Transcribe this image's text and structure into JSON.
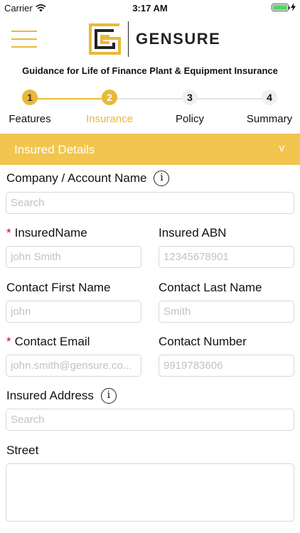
{
  "status_bar": {
    "carrier": "Carrier",
    "time": "3:17 AM",
    "battery_level": 1.0
  },
  "header": {
    "menu_icon": "hamburger-menu-icon",
    "logo_icon": "gensure-logo-mark",
    "brand": "GENSURE"
  },
  "page_title": "Guidance for Life of Finance Plant & Equipment Insurance",
  "stepper": {
    "current_step": 2,
    "steps": [
      {
        "number": "1",
        "label": "Features",
        "state": "done"
      },
      {
        "number": "2",
        "label": "Insurance",
        "state": "active"
      },
      {
        "number": "3",
        "label": "Policy",
        "state": "todo"
      },
      {
        "number": "4",
        "label": "Summary",
        "state": "todo"
      }
    ]
  },
  "section": {
    "title": "Insured Details",
    "chevron": "v"
  },
  "form": {
    "company": {
      "label": "Company / Account Name",
      "placeholder": "Search",
      "info": "i"
    },
    "insured_name": {
      "required": "*",
      "label": "InsuredName",
      "placeholder": "john Smith"
    },
    "insured_abn": {
      "label": "Insured ABN",
      "placeholder": "12345678901"
    },
    "contact_first": {
      "label": "Contact First Name",
      "placeholder": "john"
    },
    "contact_last": {
      "label": "Contact Last Name",
      "placeholder": "Smith"
    },
    "contact_email": {
      "required": "*",
      "label": "Contact Email",
      "placeholder": "john.smith@gensure.co..."
    },
    "contact_number": {
      "label": "Contact Number",
      "placeholder": "9919783606"
    },
    "insured_address": {
      "label": "Insured Address",
      "placeholder": "Search",
      "info": "i"
    },
    "street": {
      "label": "Street",
      "placeholder": ""
    }
  },
  "colors": {
    "accent": "#f2c54f",
    "accent_dark": "#e8b83a",
    "required": "#d0021b"
  }
}
